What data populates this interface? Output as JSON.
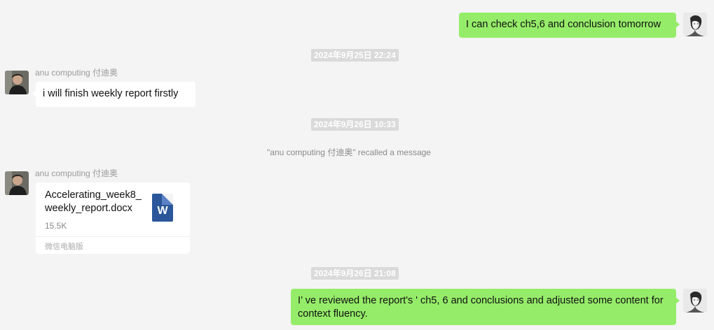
{
  "messages": {
    "m1": {
      "text": "I can check ch5,6 and conclusion tomorrow"
    },
    "ts1": "2024年9月25日 22:24",
    "m2": {
      "sender": "anu computing 付迪奥",
      "text": "i will finish weekly report firstly"
    },
    "ts2": "2024年9月26日 10:33",
    "system1": "\"anu computing 付迪奥\" recalled a message",
    "m3": {
      "sender": "anu computing 付迪奥",
      "file_name": "Accelerating_week8_weekly_report.docx",
      "file_size": "15.5K",
      "file_icon_letter": "W",
      "source": "微信电脑版"
    },
    "ts3": "2024年9月26日 21:08",
    "m4": {
      "text": "I’ ve reviewed the report's ' ch5, 6 and conclusions and adjusted some content for context fluency."
    }
  },
  "icons": {
    "self_avatar": "sketch-portrait-avatar",
    "contact_avatar": "photo-portrait-avatar",
    "file_icon": "word-document-icon"
  },
  "colors": {
    "background": "#f4f4f4",
    "outgoing_bubble": "#95ec69",
    "incoming_bubble": "#ffffff",
    "timestamp_bg": "#dadada",
    "word_blue": "#2b579a"
  }
}
